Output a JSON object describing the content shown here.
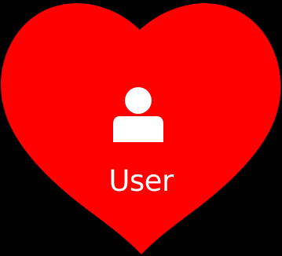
{
  "tile": {
    "label": "User",
    "icon": "user-icon",
    "heart_color": "#ff0000",
    "foreground_color": "#ffffff",
    "background_color": "#000000"
  }
}
